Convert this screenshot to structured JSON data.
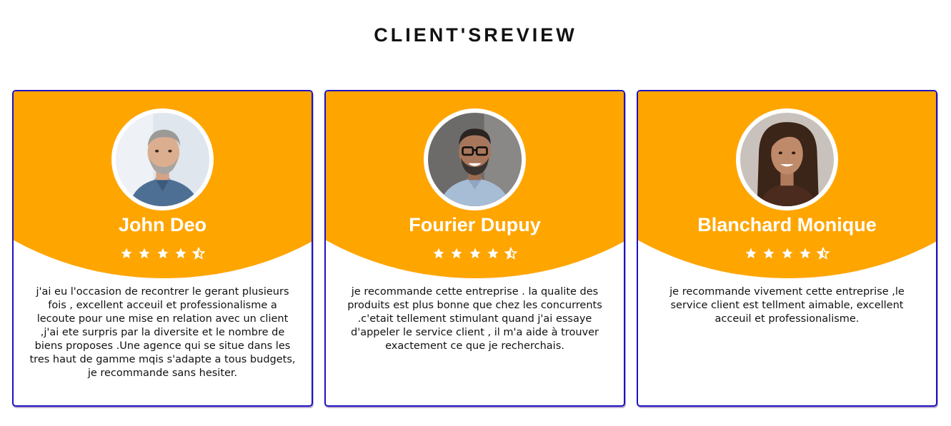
{
  "page": {
    "title": "CLIENT'SREVIEW"
  },
  "colors": {
    "accent": "#ffa500",
    "card_border": "#1c12c4",
    "star": "#ffffff"
  },
  "reviews": [
    {
      "name": "John Deo",
      "rating": 4.5,
      "avatar_icon": "man-gray-beard-avatar",
      "text": "j'ai eu l'occasion de recontrer le gerant plusieurs fois , excellent acceuil et professionalisme a lecoute pour une mise en relation avec un client ,j'ai ete surpris par la diversite et le nombre de biens proposes .Une agence qui se situe dans les tres haut de gamme mqis s'adapte a tous budgets, je recommande sans hesiter."
    },
    {
      "name": "Fourier Dupuy",
      "rating": 4.5,
      "avatar_icon": "man-glasses-avatar",
      "text": "je recommande cette entreprise . la qualite des produits est plus bonne que chez les concurrents .c'etait tellement stimulant quand j'ai essaye d'appeler le service client , il m'a aide à trouver exactement ce que je recherchais."
    },
    {
      "name": "Blanchard Monique",
      "rating": 4.5,
      "avatar_icon": "woman-avatar",
      "text": "je recommande vivement cette entreprise ,le service client est tellment aimable, excellent acceuil et professionalisme."
    }
  ]
}
